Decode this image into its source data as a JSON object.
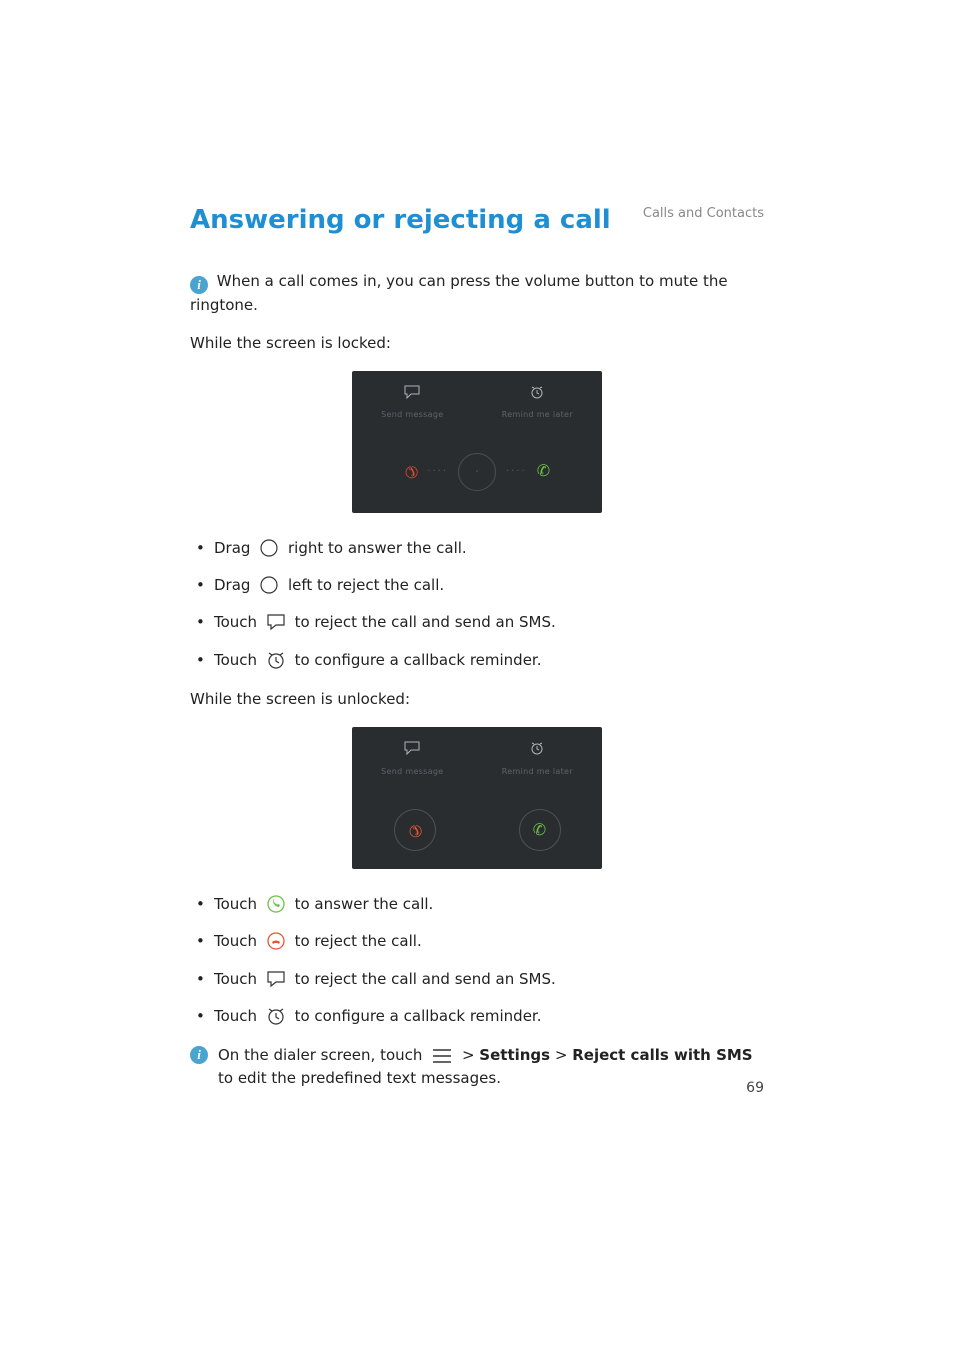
{
  "breadcrumb": "Calls and Contacts",
  "section_title": "Answering or rejecting a call",
  "info_note": "When a call comes in, you can press the volume button to mute the ringtone.",
  "locked_intro": "While the screen is locked:",
  "unlocked_intro": "While the screen is unlocked:",
  "locked_items": {
    "i0a": "Drag ",
    "i0b": " right to answer the call.",
    "i1a": "Drag ",
    "i1b": " left to reject the call.",
    "i2a": "Touch ",
    "i2b": " to reject the call and send an SMS.",
    "i3a": "Touch ",
    "i3b": " to configure a callback reminder."
  },
  "unlocked_items": {
    "i0a": "Touch ",
    "i0b": " to answer the call.",
    "i1a": "Touch ",
    "i1b": " to reject the call.",
    "i2a": "Touch ",
    "i2b": " to reject the call and send an SMS.",
    "i3a": "Touch ",
    "i3b": " to configure a callback reminder."
  },
  "tip": {
    "pre": "On the dialer screen, touch ",
    "sep1": " > ",
    "settings": "Settings",
    "sep2": " > ",
    "reject": "Reject calls with SMS",
    "post": " to edit the predefined text messages."
  },
  "ss": {
    "sms": "Send message",
    "remind": "Remind me later"
  },
  "page_number": "69"
}
